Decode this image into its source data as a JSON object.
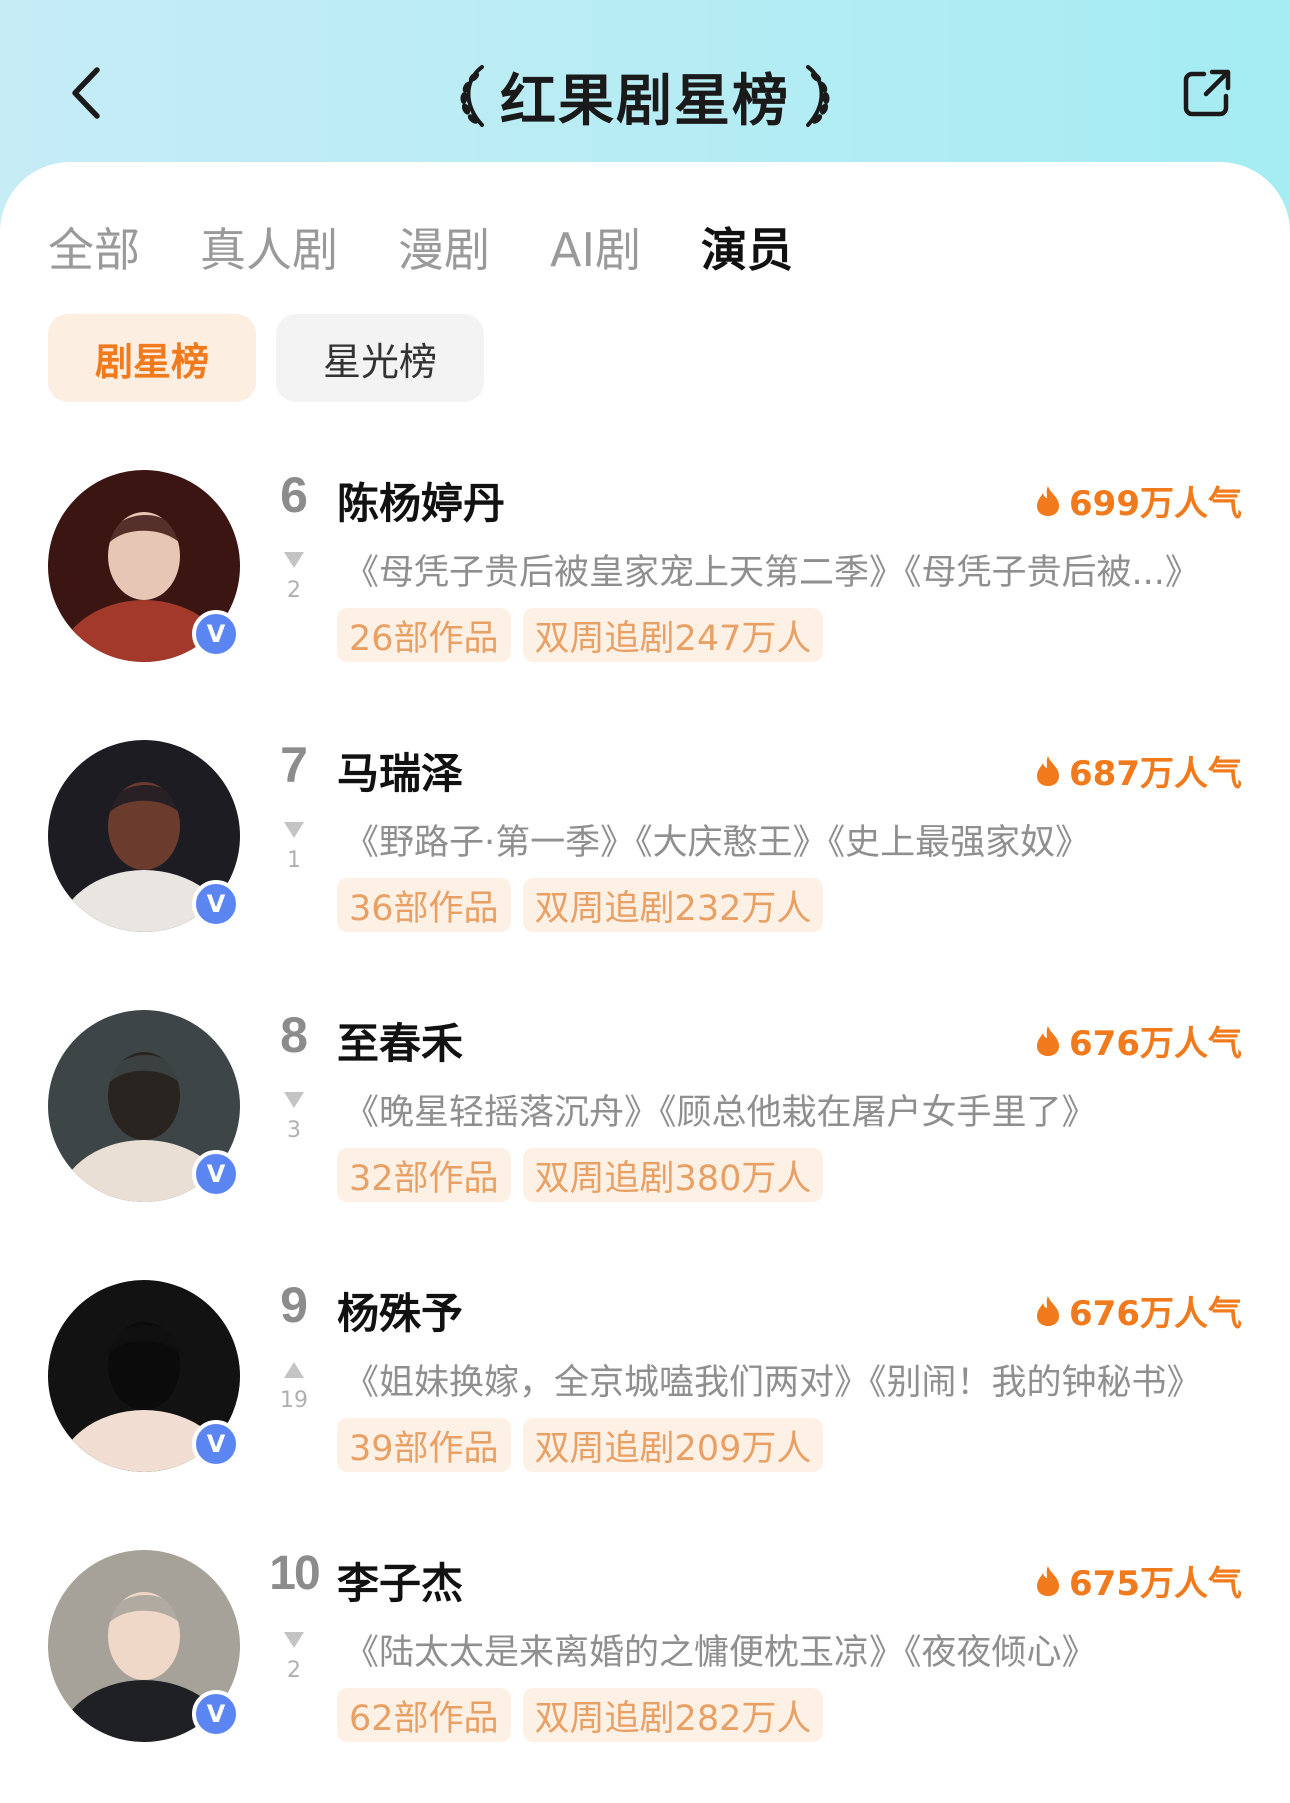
{
  "header": {
    "title": "红果剧星榜",
    "back_icon": "chevron-left-icon",
    "share_icon": "share-icon"
  },
  "tabs": [
    {
      "label": "全部",
      "active": false
    },
    {
      "label": "真人剧",
      "active": false
    },
    {
      "label": "漫剧",
      "active": false
    },
    {
      "label": "AI剧",
      "active": false
    },
    {
      "label": "演员",
      "active": true
    }
  ],
  "subtabs": [
    {
      "label": "剧星榜",
      "active": true
    },
    {
      "label": "星光榜",
      "active": false
    }
  ],
  "colors": {
    "accent": "#f07a1c",
    "tag_bg": "#fdf1e6",
    "tag_text": "#e8a064",
    "verified": "#5b86f2"
  },
  "actors": [
    {
      "rank": "6",
      "trend": "down",
      "trend_value": "2",
      "name": "陈杨婷丹",
      "heat": "699万人气",
      "works": "《母凭子贵后被皇家宠上天第二季》《母凭子贵后被...》",
      "tags": [
        "26部作品",
        "双周追剧247万人"
      ],
      "avatar_colors": [
        "#3b1512",
        "#a3392a",
        "#e8c6b5"
      ]
    },
    {
      "rank": "7",
      "trend": "down",
      "trend_value": "1",
      "name": "马瑞泽",
      "heat": "687万人气",
      "works": "《野路子·第一季》《大庆憨王》《史上最强家奴》",
      "tags": [
        "36部作品",
        "双周追剧232万人"
      ],
      "avatar_colors": [
        "#1c1c22",
        "#e9e6e2",
        "#6b3b2e"
      ]
    },
    {
      "rank": "8",
      "trend": "down",
      "trend_value": "3",
      "name": "至春禾",
      "heat": "676万人气",
      "works": "《晚星轻摇落沉舟》《顾总他栽在屠户女手里了》",
      "tags": [
        "32部作品",
        "双周追剧380万人"
      ],
      "avatar_colors": [
        "#3e4547",
        "#eadfd5",
        "#2a2420"
      ]
    },
    {
      "rank": "9",
      "trend": "up",
      "trend_value": "19",
      "name": "杨殊予",
      "heat": "676万人气",
      "works": "《姐妹换嫁，全京城嗑我们两对》《别闹！我的钟秘书》",
      "tags": [
        "39部作品",
        "双周追剧209万人"
      ],
      "avatar_colors": [
        "#121212",
        "#f1ddd2",
        "#0b0b0b"
      ]
    },
    {
      "rank": "10",
      "trend": "down",
      "trend_value": "2",
      "name": "李子杰",
      "heat": "675万人气",
      "works": "《陆太太是来离婚的之慵便枕玉凉》《夜夜倾心》",
      "tags": [
        "62部作品",
        "双周追剧282万人"
      ],
      "avatar_colors": [
        "#a6a29a",
        "#1e2024",
        "#f0d8c8"
      ]
    }
  ]
}
